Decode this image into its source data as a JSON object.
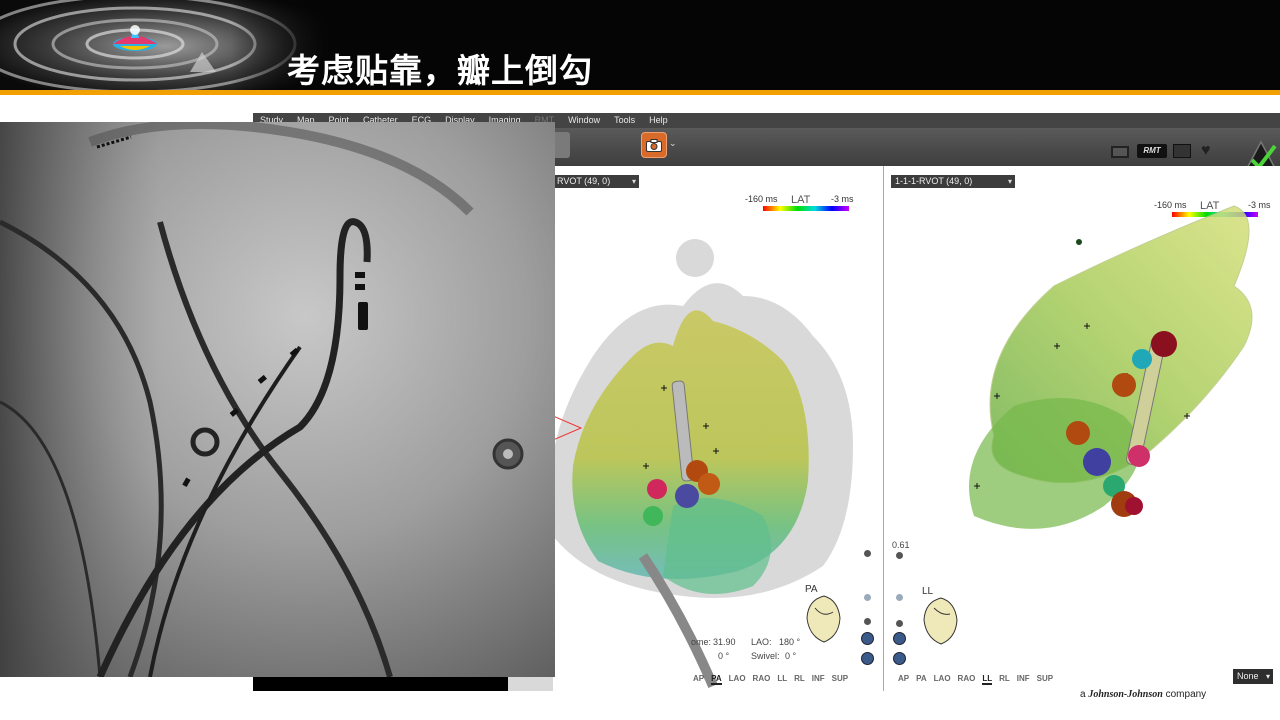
{
  "slide": {
    "title": "考虑贴靠，瓣上倒勾",
    "footer_brand": "Johnson-Johnson",
    "footer_prefix": "a",
    "footer_suffix": "company",
    "accent_color": "#f2a000"
  },
  "app": {
    "menu": [
      "Study",
      "Map",
      "Point",
      "Catheter",
      "ECG",
      "Display",
      "Imaging",
      "RMT",
      "Window",
      "Tools",
      "Help"
    ],
    "toolbar": {
      "camera_icon": "camera-icon",
      "rmt_label": "RMT",
      "status_icon": "checkmark-triangle-icon"
    },
    "left_panel": {
      "map_name": "RVOT (49, 0)",
      "lat_title": "LAT",
      "lat_min": "-160 ms",
      "lat_max": "-3 ms",
      "view_name": "PA",
      "readout_zoom_label": "ome:",
      "readout_zoom_value": "31.90",
      "readout_lao_label": "LAO:",
      "readout_lao_value": "180 °",
      "readout_swivel_label": "Swivel:",
      "readout_swivel_value": "0 °",
      "readout_other_value": "0 °",
      "orientations": [
        "AP",
        "PA",
        "LAO",
        "RAO",
        "LL",
        "RL",
        "INF",
        "SUP"
      ],
      "active_orientation": "PA"
    },
    "right_panel": {
      "map_name": "1-1-1-RVOT (49, 0)",
      "lat_title": "LAT",
      "lat_min": "-160 ms",
      "lat_max": "-3 ms",
      "view_name": "LL",
      "slider_value": "0.61",
      "orientations": [
        "AP",
        "PA",
        "LAO",
        "RAO",
        "LL",
        "RL",
        "INF",
        "SUP"
      ],
      "active_orientation": "LL",
      "display_select": "None"
    }
  }
}
